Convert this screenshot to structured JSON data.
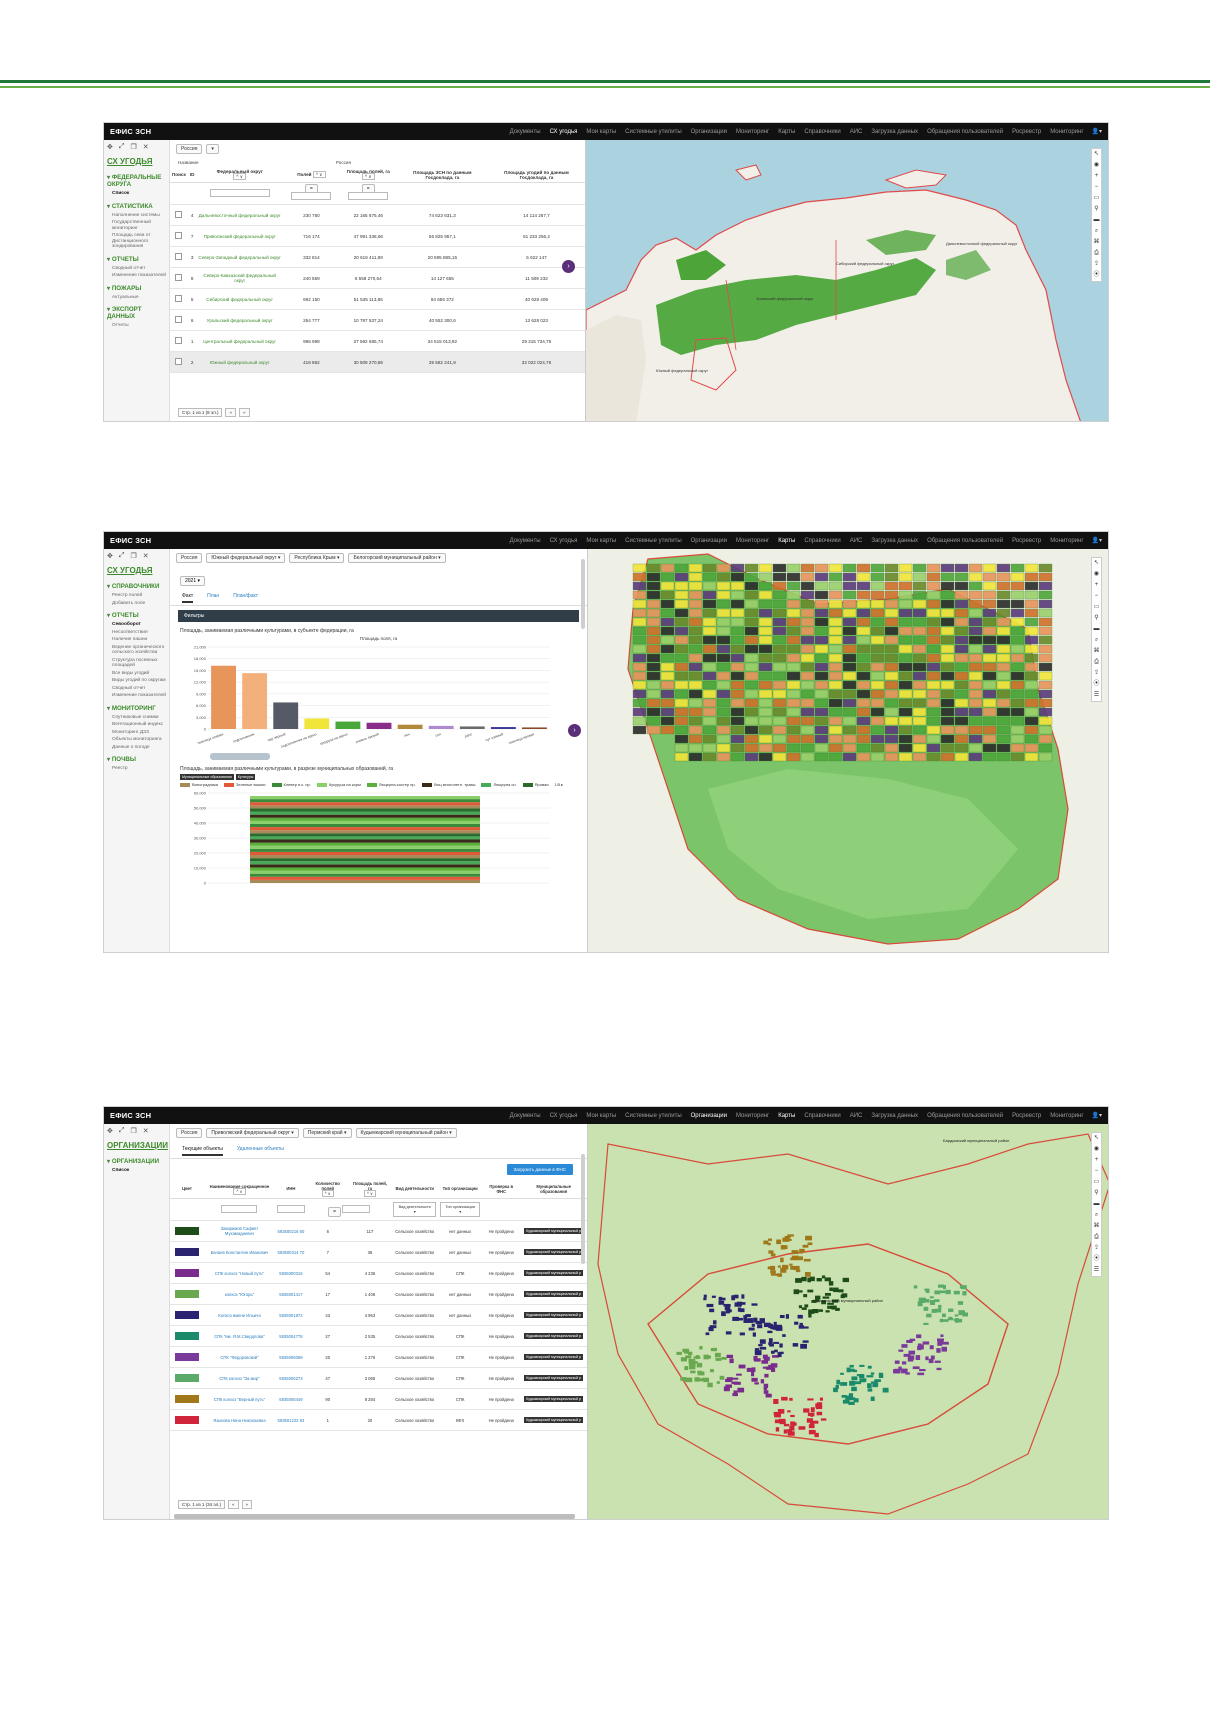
{
  "app": {
    "brand": "ЕФИС ЗСН"
  },
  "nav1": [
    "Документы",
    "СХ угодья",
    "Мои карты",
    "Системные утилиты",
    "Организации",
    "Мониторинг",
    "Карты",
    "Справочники",
    "АИС",
    "Загрузка данных",
    "Обращения пользователей",
    "Росреестр",
    "Мониторинг"
  ],
  "nav2": [
    "Документы",
    "СХ угодья",
    "Мои карты",
    "Системные утилиты",
    "Организации",
    "Мониторинг",
    "Карты",
    "Справочники",
    "АИС",
    "Загрузка данных",
    "Обращения пользователей",
    "Росреестр",
    "Мониторинг"
  ],
  "nav3": [
    "Документы",
    "СХ угодья",
    "Мои карты",
    "Системные утилиты",
    "Организации",
    "Мониторинг",
    "Карты",
    "Справочники",
    "АИС",
    "Загрузка данных",
    "Обращения пользователей",
    "Росреестр",
    "Мониторинг"
  ],
  "shot1": {
    "sidebar": {
      "title": "СХ УГОДЬЯ",
      "sections": [
        {
          "label": "ФЕДЕРАЛЬНЫЕ ОКРУГА",
          "items": [
            "Список"
          ]
        },
        {
          "label": "СТАТИСТИКА",
          "items": [
            "Наполнение системы",
            "Государственный мониторинг",
            "Площадь сева от Дистанционного зондирования"
          ]
        },
        {
          "label": "ОТЧЕТЫ",
          "items": [
            "Сводный отчет",
            "Изменение показателей"
          ]
        },
        {
          "label": "ПОЖАРЫ",
          "items": [
            "Актуальные"
          ]
        },
        {
          "label": "ЭКСПОРТ ДАННЫХ",
          "items": [
            "Отчеты"
          ]
        }
      ]
    },
    "crumb": "Россия",
    "name_label": "Название",
    "name_value": "Россия",
    "headers": [
      "Поиск",
      "ID",
      "Федеральный округ",
      "Полей",
      "Площадь полей, га",
      "Площадь ЗСН по данным Госдоклада, га",
      "Площадь угодий по данным Госдоклада, га"
    ],
    "rows": [
      {
        "id": "4",
        "name": "Дальневосточный федеральный округ",
        "fields": "230 760",
        "area": "22 165 675,46",
        "zsn": "74 623 631,3",
        "ugod": "14 114 257,7"
      },
      {
        "id": "7",
        "name": "Приволжский федеральный округ",
        "fields": "716 174",
        "area": "47 991 338,66",
        "zsn": "56 825 957,1",
        "ugod": "51 233 256,2"
      },
      {
        "id": "3",
        "name": "Северо-Западный федеральный округ",
        "fields": "332 814",
        "area": "20 616 411,89",
        "zsn": "20 595 885,15",
        "ugod": "5 622 147"
      },
      {
        "id": "8",
        "name": "Северо-Кавказский федеральный округ",
        "fields": "240 559",
        "area": "6 558 270,54",
        "zsn": "14 127 655",
        "ugod": "11 509 232"
      },
      {
        "id": "5",
        "name": "Сибирский федеральный округ",
        "fields": "692 150",
        "area": "51 535 113,86",
        "zsn": "84 656 372",
        "ugod": "40 628 409"
      },
      {
        "id": "6",
        "name": "Уральский федеральный округ",
        "fields": "264 777",
        "area": "10 787 537,24",
        "zsn": "40 552 300,6",
        "ugod": "13 628 023"
      },
      {
        "id": "1",
        "name": "Центральный федеральный округ",
        "fields": "995 998",
        "area": "27 592 685,74",
        "zsn": "34 515 013,92",
        "ugod": "29 315 734,75"
      },
      {
        "id": "2",
        "name": "Южный федеральный округ",
        "fields": "418 862",
        "area": "30 509 270,86",
        "zsn": "35 582 241,9",
        "ugod": "32 022 024,76"
      }
    ],
    "pager": "Стр. 1 из 1 (8 эл.)",
    "map_labels": [
      "Сибирский федеральный округ",
      "Дальневосточный федеральный округ",
      "Уральский федеральный округ",
      "Южный федеральный округ"
    ]
  },
  "shot2": {
    "sidebar": {
      "title": "СХ УГОДЬЯ",
      "sections": [
        {
          "label": "СПРАВОЧНИКИ",
          "items": [
            "Реестр полей",
            "Добавить поле"
          ]
        },
        {
          "label": "ОТЧЕТЫ",
          "items": [
            "Севооборот",
            "Несоответствия",
            "Наличие пашни",
            "Ведение органического сельского хозяйства",
            "Структура посевных площадей",
            "Все виды угодий",
            "Виды угодий по округам",
            "Сводный отчет",
            "Изменение показателей"
          ]
        },
        {
          "label": "МОНИТОРИНГ",
          "items": [
            "Спутниковые снимки",
            "Вегетационный индекс",
            "Мониторинг ДЗЗ",
            "Объекты мониторинга",
            "Данные о погоде"
          ]
        },
        {
          "label": "ПОЧВЫ",
          "items": [
            "Реестр"
          ]
        }
      ]
    },
    "crumbs": [
      "Россия",
      "Южный федеральный округ ▾",
      "Республика Крым ▾",
      "Белогорский муниципальный район ▾"
    ],
    "year": "2021 ▾",
    "tabs": [
      "Факт",
      "План",
      "План/факт"
    ],
    "filters_label": "Фильтры",
    "chart1_title": "Площадь, занимаемая различными культурами, в субъекте федерации, га",
    "chart1_subtitle": "Площадь поля, га",
    "chart2_title": "Площадь, занимаемая различными культурами, в разрезе муниципальных образований, га",
    "chart2_tags": [
      "Муниципальные образования",
      "Культуры"
    ],
    "legend": [
      "Виноградники",
      "Зеленые вишни",
      "Клевер н.к. пр.",
      "Кукуруза на корм",
      "Люцерна-костер пр.",
      "Люц многолетн. травы",
      "Люцерна сн.",
      "Яровая"
    ],
    "legend_page": "1/5 ▸"
  },
  "shot3": {
    "sidebar": {
      "title": "ОРГАНИЗАЦИИ",
      "sections": [
        {
          "label": "ОРГАНИЗАЦИИ",
          "items": [
            "Список"
          ]
        }
      ]
    },
    "crumbs": [
      "Россия",
      "Приволжский федеральный округ ▾",
      "Пермский край ▾",
      "Кудымкарский муниципальный район ▾"
    ],
    "tabs": [
      "Текущие объекты",
      "Удаленные объекты"
    ],
    "load_button": "Загрузить данные в ФНС",
    "headers": [
      "Цвет",
      "Наименование сокращенное",
      "ИНН",
      "Количество полей",
      "Площадь полей, га",
      "Вид деятельности",
      "Тип организации",
      "Проверка в ФНС",
      "Муниципальные образования"
    ],
    "filter_labels": [
      "Вид деятельности ▾",
      "Тип организации ▾"
    ],
    "rows": [
      {
        "color": "#1f4d1a",
        "name": "Закиримов Сафият Мухамадиевич",
        "inn": "593500216 60",
        "fields": "6",
        "area": "117",
        "activity": "Сельское хозяйство",
        "type": "нет данных",
        "check": "Не пройдена",
        "mo": "Кудымкарский муниципальный р"
      },
      {
        "color": "#2a2470",
        "name": "Бачаев Константин Иванович",
        "inn": "593500314 70",
        "fields": "7",
        "area": "36",
        "activity": "Сельское хозяйство",
        "type": "нет данных",
        "check": "Не пройдена",
        "mo": "Кудымкарский муниципальный р"
      },
      {
        "color": "#7a2c8c",
        "name": "СПК колхоз \"Новый путь\"",
        "inn": "5935000316",
        "fields": "54",
        "area": "4 236",
        "activity": "Сельское хозяйство",
        "type": "СПК",
        "check": "Не пройдена",
        "mo": "Кудымкарский муниципальный р"
      },
      {
        "color": "#6aa84f",
        "name": "колхоз \"Югорь\"",
        "inn": "5935001417",
        "fields": "17",
        "area": "1 406",
        "activity": "Сельское хозяйство",
        "type": "нет данных",
        "check": "Не пройдена",
        "mo": "Кудымкарский муниципальный р"
      },
      {
        "color": "#2a2470",
        "name": "Колхоз имени Ильича",
        "inn": "5935001872",
        "fields": "43",
        "area": "4 953",
        "activity": "Сельское хозяйство",
        "type": "нет данных",
        "check": "Не пройдена",
        "mo": "Кудымкарский муниципальный р"
      },
      {
        "color": "#1a8a6a",
        "name": "СПК \"им. Я.М.Свердлова\"",
        "inn": "5935004778",
        "fields": "27",
        "area": "2 535",
        "activity": "Сельское хозяйство",
        "type": "СПК",
        "check": "Не пройдена",
        "mo": "Кудымкарский муниципальный р"
      },
      {
        "color": "#7a3a9a",
        "name": "СПК \"Федоровский\"",
        "inn": "5935006069",
        "fields": "20",
        "area": "1 276",
        "activity": "Сельское хозяйство",
        "type": "СПК",
        "check": "Не пройдена",
        "mo": "Кудымкарский муниципальный р"
      },
      {
        "color": "#5aaa6a",
        "name": "СПК колхоз \"За мир\"",
        "inn": "5935006273",
        "fields": "47",
        "area": "3 065",
        "activity": "Сельское хозяйство",
        "type": "СПК",
        "check": "Не пройдена",
        "mo": "Кудымкарский муниципальный р"
      },
      {
        "color": "#a0781a",
        "name": "СПК колхоз \"Верный путь\"",
        "inn": "5935006449",
        "fields": "90",
        "area": "8 284",
        "activity": "Сельское хозяйство",
        "type": "СПК",
        "check": "Не пройдена",
        "mo": "Кудымкарский муниципальный р"
      },
      {
        "color": "#d0243a",
        "name": "Языкова Нина Николаевна",
        "inn": "593501222 93",
        "fields": "1",
        "area": "20",
        "activity": "Сельское хозяйство",
        "type": "КФХ",
        "check": "Не пройдена",
        "mo": "Кудымкарский муниципальный р"
      }
    ],
    "pager": "Стр. 1 из 1 (34 эл.)",
    "map_labels": [
      "Кудымкарский муниципальный район",
      "Бардымский муниципальный район"
    ]
  },
  "chart_data": [
    {
      "type": "bar",
      "title": "Площадь, занимаемая различными культурами, в субъекте федерации, га",
      "subtitle": "Площадь поля, га",
      "categories": [
        "пшеница озимая",
        "подсолнечник",
        "пар черный",
        "подсолнечник на зерно",
        "кукуруза на зерно",
        "ячмень яровой",
        "лен",
        "соя",
        "рапс",
        "нут озимый",
        "пшеница яровая"
      ],
      "values": [
        16200,
        14300,
        6800,
        2700,
        1900,
        1600,
        1100,
        800,
        650,
        500,
        400
      ],
      "colors": [
        "#e8955c",
        "#f4b07a",
        "#555b66",
        "#f2e53a",
        "#4aa83a",
        "#8a2c8a",
        "#b08a3a",
        "#b08ad0",
        "#6a6a6a",
        "#3a3a9a",
        "#8a4a2a"
      ],
      "ylim": [
        0,
        21000
      ],
      "yticks": [
        "21,000",
        "18,000",
        "15,000",
        "12,000",
        "9,000",
        "6,000",
        "3,000",
        "0"
      ]
    },
    {
      "type": "bar",
      "title": "Площадь, занимаемая различными культурами, в разрезе муниципальных образований, га",
      "categories": [
        ""
      ],
      "ylim": [
        0,
        60000
      ],
      "yticks": [
        "60,000",
        "50,000",
        "40,000",
        "30,000",
        "20,000",
        "10,000",
        "0"
      ],
      "total": 58000,
      "series": [
        {
          "name": "Виноградники",
          "color": "#a88a5a"
        },
        {
          "name": "Зеленые вишни",
          "color": "#e05a3a"
        },
        {
          "name": "Клевер н.к. пр.",
          "color": "#3a8a3a"
        },
        {
          "name": "Кукуруза на корм",
          "color": "#8ad06a"
        },
        {
          "name": "Люцерна-костер пр.",
          "color": "#5ab03a"
        },
        {
          "name": "Люц многолетн. травы",
          "color": "#3a2a1a"
        },
        {
          "name": "Люцерна сн.",
          "color": "#4aa85a"
        },
        {
          "name": "Яровая",
          "color": "#2a6a2a"
        }
      ]
    }
  ]
}
